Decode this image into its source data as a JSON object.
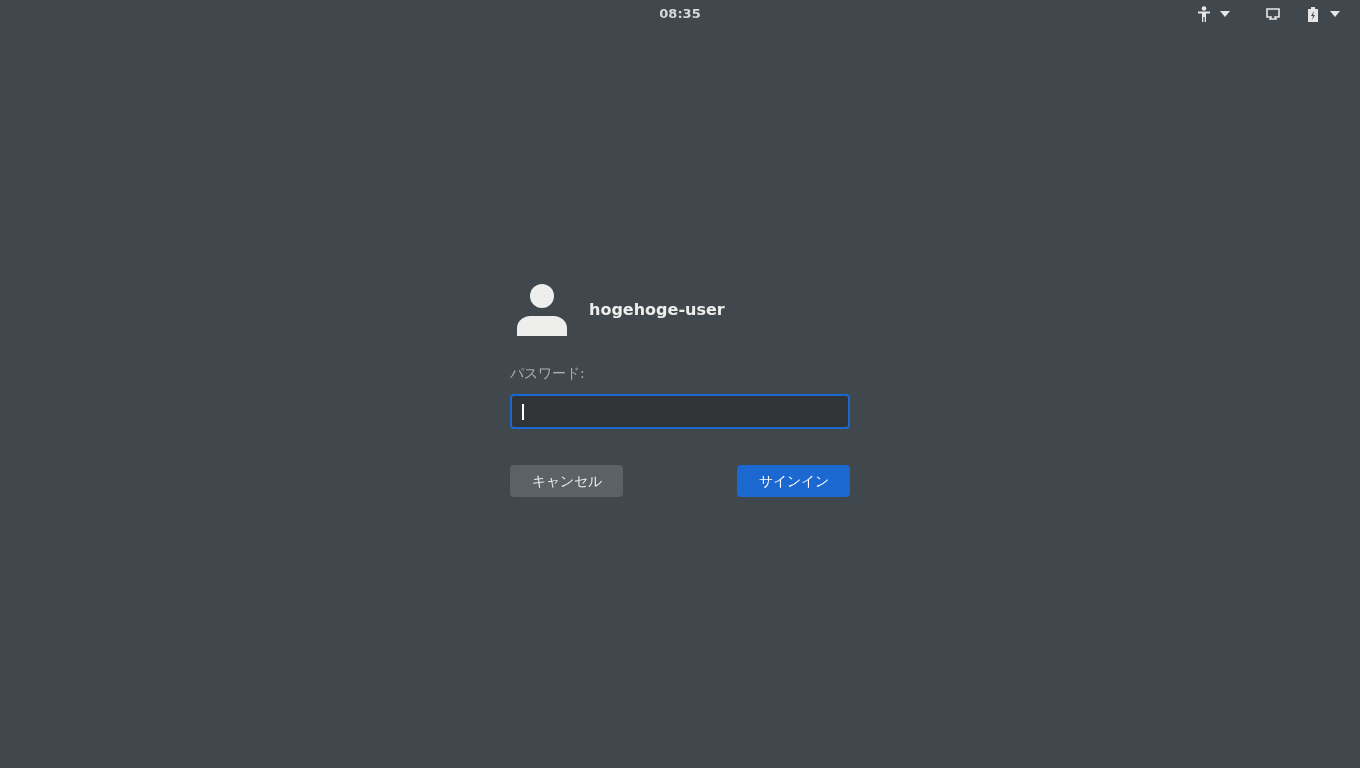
{
  "top_bar": {
    "clock": "08:35"
  },
  "login": {
    "user_name": "hogehoge-user",
    "password_label": "パスワード:",
    "password_field": {
      "focused": true
    },
    "buttons": [
      {
        "label": "キャンセル",
        "kind": "secondary"
      },
      {
        "label": "サインイン",
        "kind": "primary"
      }
    ]
  }
}
